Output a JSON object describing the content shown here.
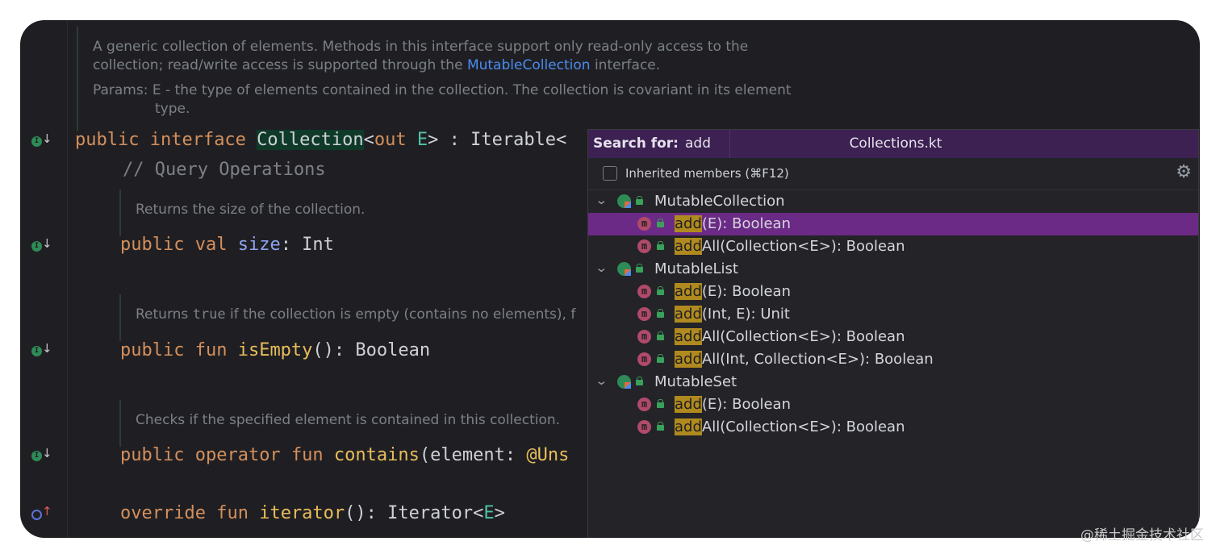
{
  "doc_top": {
    "line1": "A generic collection of elements. Methods in this interface support only read-only access to the",
    "line2_pre": "collection; read/write access is supported through the ",
    "line2_link": "MutableCollection",
    "line2_post": " interface.",
    "params_line1": "Params: E - the type of elements contained in the collection. The collection is covariant in its element",
    "params_line2": "type."
  },
  "code": {
    "line1": {
      "kw1": "public ",
      "kw2": "interface ",
      "name": "Collection",
      "lt": "<",
      "out": "out ",
      "E": "E",
      "rest": "> : Iterable<"
    },
    "comment": "// Query Operations",
    "doc_size": "Returns the size of the collection.",
    "line_size": {
      "kw1": "public ",
      "kw2": "val ",
      "prop": "size",
      "rest": ": Int"
    },
    "doc_isempty_pre": "Returns ",
    "doc_isempty_code": "true",
    "doc_isempty_post": " if the collection is empty (contains no elements), f",
    "line_isempty": {
      "kw1": "public ",
      "kw2": "fun ",
      "fn": "isEmpty",
      "rest": "(): Boolean"
    },
    "doc_contains": "Checks if the specified element is contained in this collection.",
    "line_contains": {
      "kw1": "public ",
      "kw2": "operator ",
      "kw3": "fun ",
      "fn": "contains",
      "rest": "(element: ",
      "ann": "@Uns"
    },
    "line_iterator": {
      "kw1": "override ",
      "kw2": "fun ",
      "fn": "iterator",
      "rest": "(): Iterator<",
      "E": "E",
      "end": ">"
    }
  },
  "popup": {
    "search_label": "Search for:",
    "search_value": "add",
    "file_title": "Collections.kt",
    "inherited_label": "Inherited members (⌘F12)",
    "inherited_checked": false,
    "selected_color": "#6b2a86",
    "match_color": "#b08a1e",
    "groups": [
      {
        "name": "MutableCollection",
        "items": [
          {
            "match": "add",
            "rest": "(E): Boolean",
            "selected": true
          },
          {
            "match": "add",
            "rest": "All(Collection<E>): Boolean",
            "selected": false
          }
        ]
      },
      {
        "name": "MutableList",
        "items": [
          {
            "match": "add",
            "rest": "(E): Boolean",
            "selected": false
          },
          {
            "match": "add",
            "rest": "(Int, E): Unit",
            "selected": false
          },
          {
            "match": "add",
            "rest": "All(Collection<E>): Boolean",
            "selected": false
          },
          {
            "match": "add",
            "rest": "All(Int, Collection<E>): Boolean",
            "selected": false
          }
        ]
      },
      {
        "name": "MutableSet",
        "items": [
          {
            "match": "add",
            "rest": "(E): Boolean",
            "selected": false
          },
          {
            "match": "add",
            "rest": "All(Collection<E>): Boolean",
            "selected": false
          }
        ]
      }
    ]
  },
  "watermark": "@稀土掘金技术社区"
}
